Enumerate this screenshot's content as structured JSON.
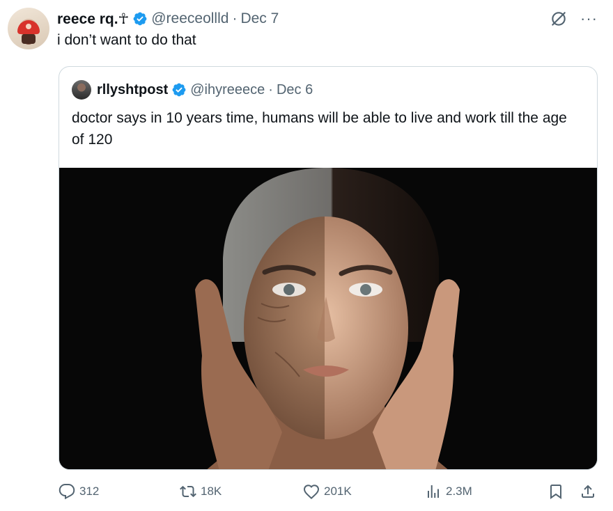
{
  "tweet": {
    "author_name": "reece rq.☥",
    "handle": "@reeceollld",
    "separator": "·",
    "date": "Dec 7",
    "text": "i don’t want to do that"
  },
  "quote": {
    "author_name": "rllyshtpost",
    "handle": "@ihyreeece",
    "separator": "·",
    "date": "Dec 6",
    "text": "doctor says in 10 years time, humans will be able to live and work till the age of 120"
  },
  "actions": {
    "replies": "312",
    "reposts": "18K",
    "likes": "201K",
    "views": "2.3M"
  },
  "colors": {
    "verified": "#1d9bf0",
    "muted": "#536471",
    "border": "#cfd9de"
  },
  "icons": [
    "grok-icon",
    "more-icon",
    "verified-badge-icon",
    "reply-icon",
    "repost-icon",
    "like-icon",
    "views-icon",
    "bookmark-icon",
    "share-icon"
  ]
}
